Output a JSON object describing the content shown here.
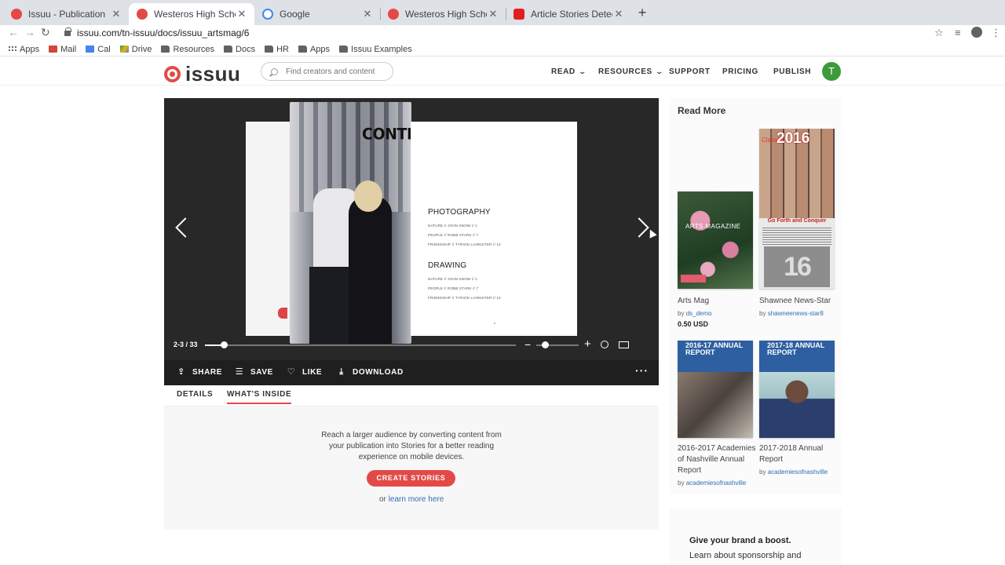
{
  "browser": {
    "tabs": [
      {
        "title": "Issuu - Publication",
        "favicon_color": "#e34a47"
      },
      {
        "title": "Westeros High School by Tina",
        "favicon_color": "#e34a47",
        "active": true
      },
      {
        "title": "Google",
        "favicon_color": "#4285f4"
      },
      {
        "title": "Westeros High School by Tina",
        "favicon_color": "#e34a47"
      },
      {
        "title": "Article Stories Detection with",
        "favicon_color": "#e02020"
      }
    ],
    "url": "issuu.com/tn-issuu/docs/issuu_artsmag/6",
    "bookmarks": [
      "Apps",
      "Mail",
      "Cal",
      "Drive",
      "Resources",
      "Docs",
      "HR",
      "Apps",
      "Issuu Examples"
    ]
  },
  "header": {
    "logo": "issuu",
    "search_placeholder": "Find creators and content",
    "nav": [
      "READ",
      "RESOURCES",
      "SUPPORT",
      "PRICING",
      "PUBLISH"
    ],
    "user_initial": "T"
  },
  "reader": {
    "contents_title": "CONTENTS",
    "sections": [
      {
        "heading": "PHOTOGRAPHY",
        "items": [
          "NATURE // JOHN SNOW // 1",
          "PEOPLE // ROBB STARK // 7",
          "FRIENDSHIP // TYRION LANNISTER // 12"
        ]
      },
      {
        "heading": "DRAWING",
        "items": [
          "NATURE // JOHN SNOW // 1",
          "PEOPLE // ROBB STARK // 7",
          "FRIENDSHIP // TYRION LANNISTER // 12"
        ]
      }
    ],
    "page_count": "2-3 / 33",
    "progress": 0.06,
    "zoom_level": 0.2,
    "actions": {
      "share": "SHARE",
      "save": "SAVE",
      "like": "LIKE",
      "download": "DOWNLOAD"
    }
  },
  "subtabs": {
    "details": "DETAILS",
    "inside": "WHAT'S INSIDE"
  },
  "stories": {
    "message": "Reach a larger audience by converting content from your publication into Stories for a better reading experience on mobile devices.",
    "cta": "CREATE STORIES",
    "learn_prefix": "or",
    "learn_link": "learn more here"
  },
  "sidebar": {
    "title": "Read More",
    "cards": [
      {
        "name": "Arts Mag",
        "by": "by",
        "author": "ds_demo",
        "price": "0.50 USD",
        "thumb_label": "ARTS MAGAZINE"
      },
      {
        "name": "Shawnee News-Star",
        "by": "by",
        "author": "shawneenews-star8",
        "thumb_year": "2016",
        "thumb_class": "Class of",
        "thumb_band": "Go Forth and Conquer"
      },
      {
        "name": "2016-2017 Academies of Nashville Annual Report",
        "by": "by",
        "author": "academiesofnashville",
        "thumb_label": "2016-17 ANNUAL REPORT"
      },
      {
        "name": "2017-2018 Annual Report",
        "by": "by",
        "author": "academiesofnashville",
        "thumb_label": "2017-18 ANNUAL REPORT"
      }
    ]
  },
  "promo": {
    "heading": "Give your brand a boost.",
    "text": "Learn about sponsorship and"
  }
}
